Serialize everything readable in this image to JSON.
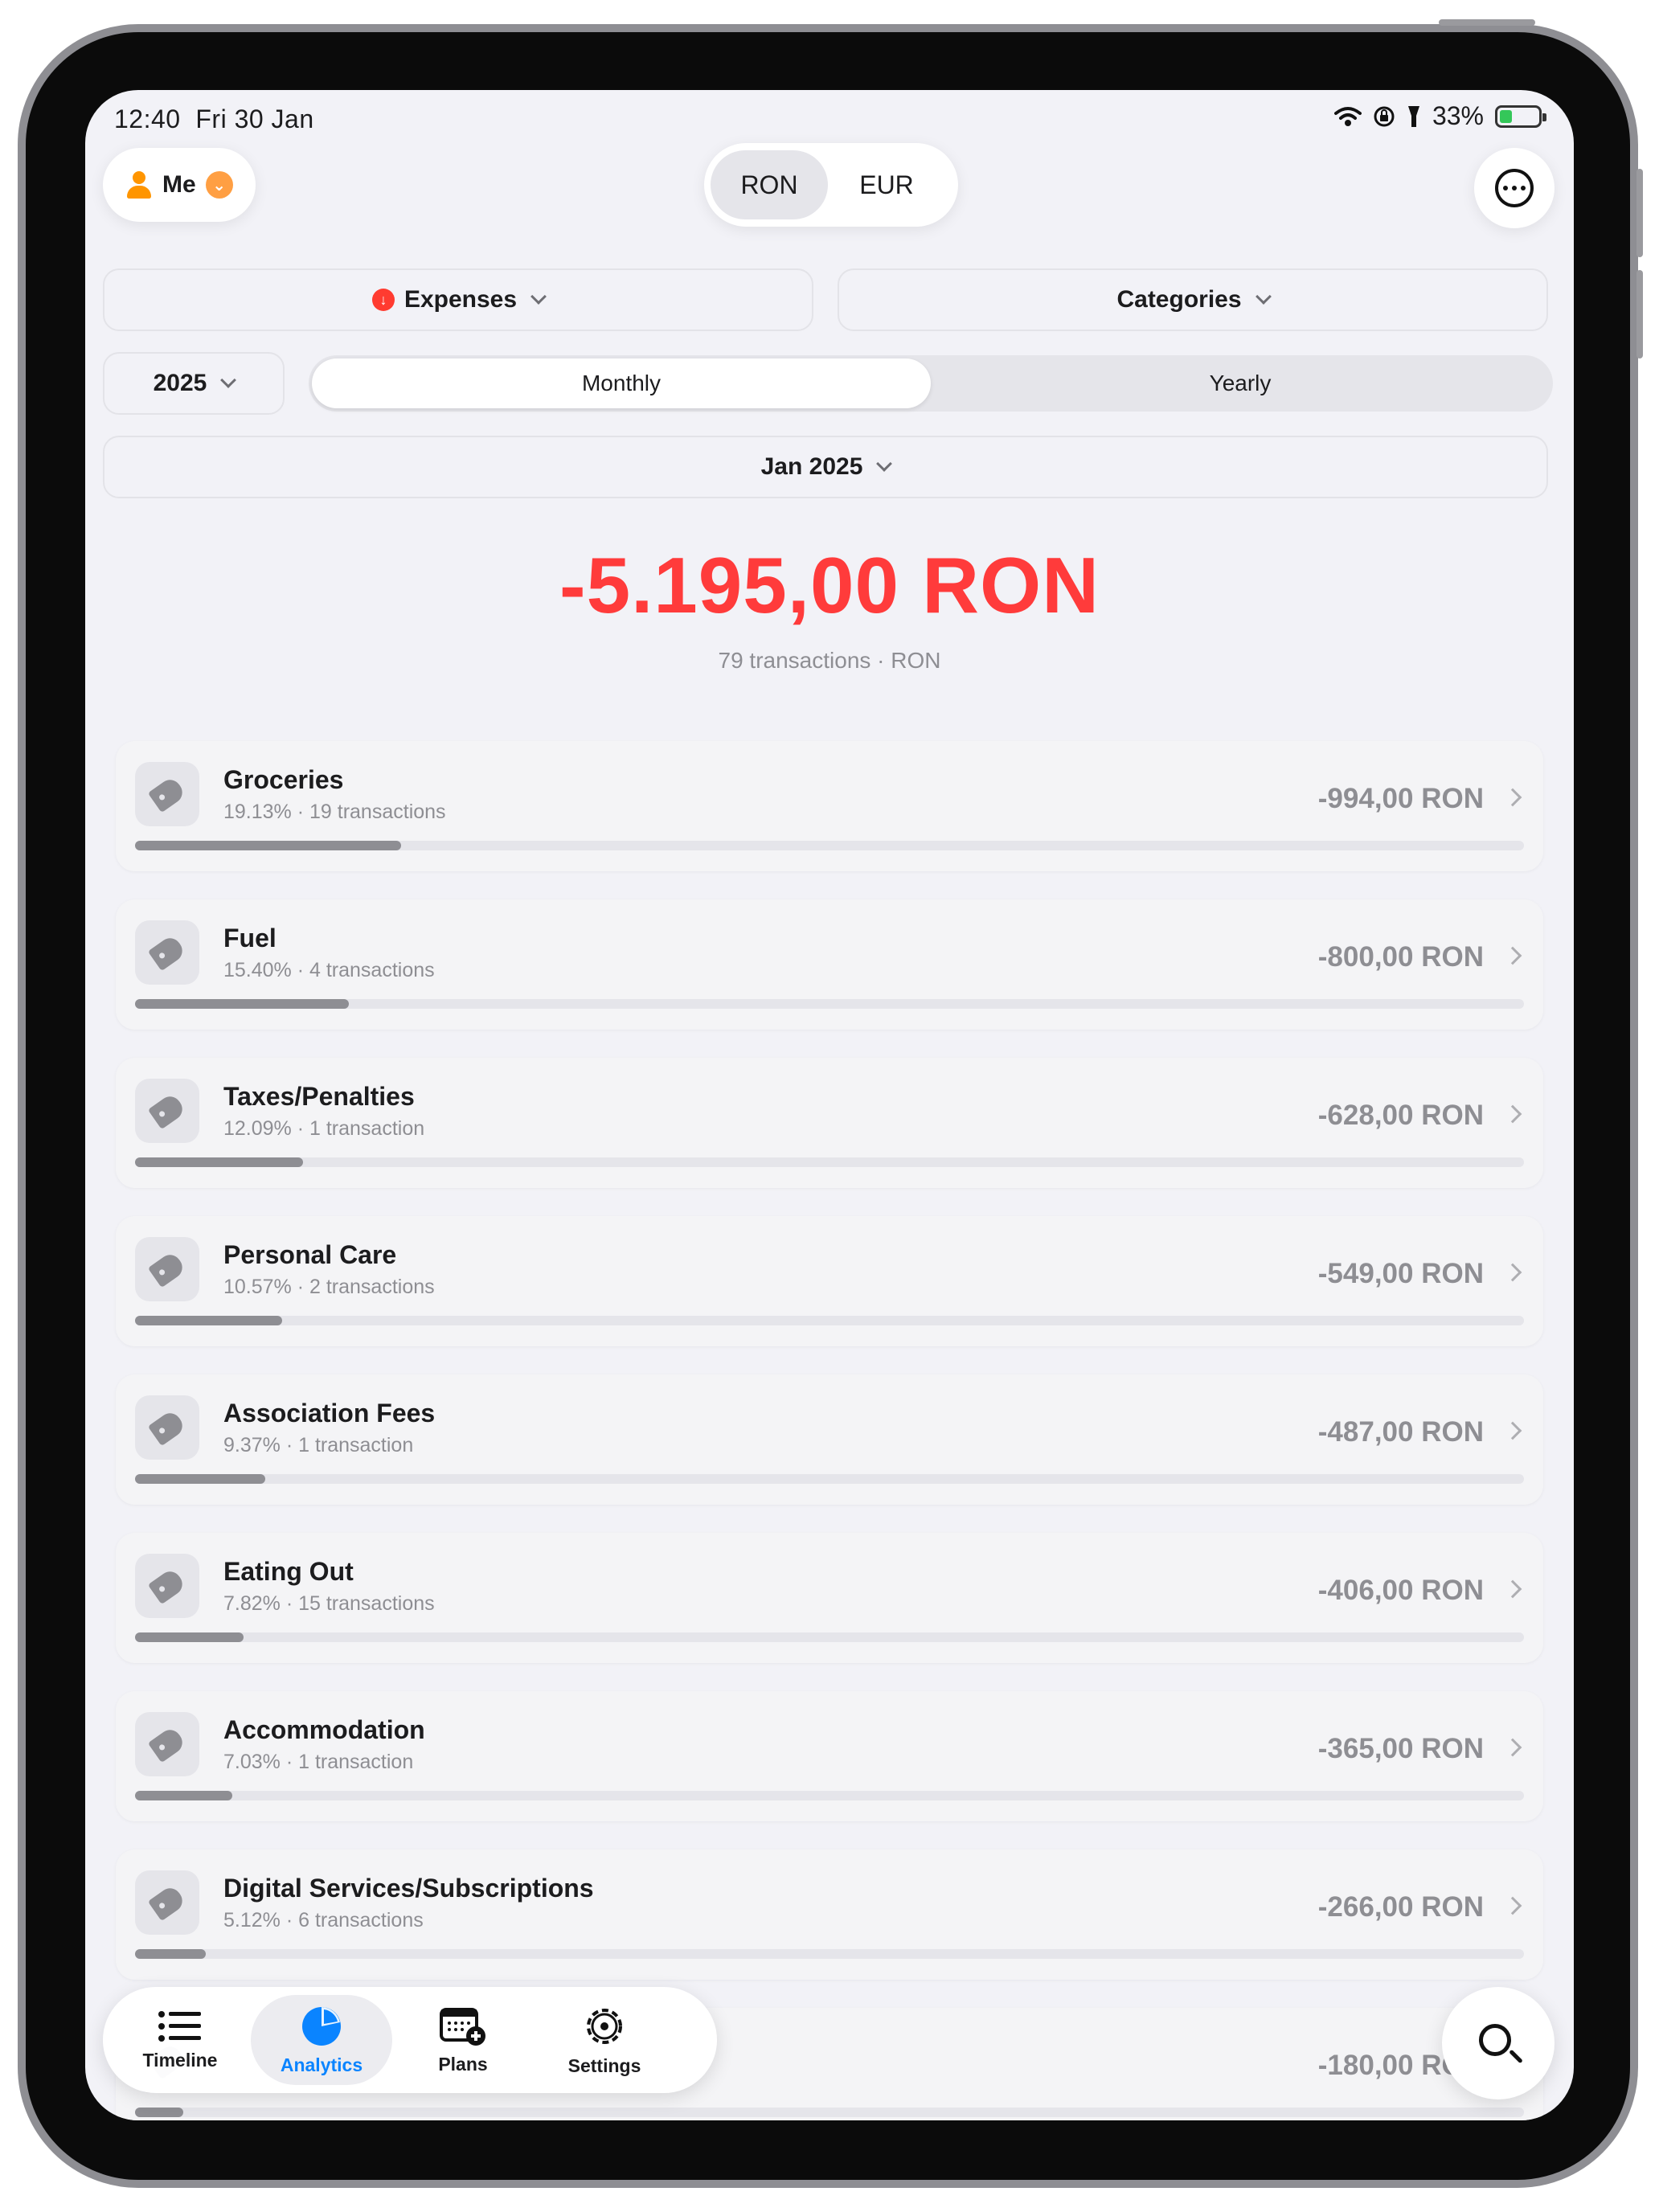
{
  "status": {
    "time": "12:40",
    "date": "Fri 30 Jan",
    "battery": "33%"
  },
  "header": {
    "profile_label": "Me",
    "currencies": [
      "RON",
      "EUR"
    ],
    "selected_currency": "RON"
  },
  "filters": {
    "type_label": "Expenses",
    "group_label": "Categories",
    "year_label": "2025",
    "periods": [
      "Monthly",
      "Yearly"
    ],
    "selected_period": "Monthly",
    "month_label": "Jan 2025"
  },
  "summary": {
    "total": "-5.195,00 RON",
    "subtitle": "79 transactions · RON"
  },
  "categories": [
    {
      "name": "Groceries",
      "meta": "19.13% · 19 transactions",
      "amount": "-994,00 RON",
      "share": 0.1913
    },
    {
      "name": "Fuel",
      "meta": "15.40% · 4 transactions",
      "amount": "-800,00 RON",
      "share": 0.154
    },
    {
      "name": "Taxes/Penalties",
      "meta": "12.09% · 1 transaction",
      "amount": "-628,00 RON",
      "share": 0.1209
    },
    {
      "name": "Personal Care",
      "meta": "10.57% · 2 transactions",
      "amount": "-549,00 RON",
      "share": 0.1057
    },
    {
      "name": "Association Fees",
      "meta": "9.37% · 1 transaction",
      "amount": "-487,00 RON",
      "share": 0.0937
    },
    {
      "name": "Eating Out",
      "meta": "7.82% · 15 transactions",
      "amount": "-406,00 RON",
      "share": 0.0782
    },
    {
      "name": "Accommodation",
      "meta": "7.03% · 1 transaction",
      "amount": "-365,00 RON",
      "share": 0.0703
    },
    {
      "name": "Digital Services/Subscriptions",
      "meta": "5.12% · 6 transactions",
      "amount": "-266,00 RON",
      "share": 0.0512
    },
    {
      "name": "",
      "meta": "",
      "amount": "-180,00 RON",
      "share": 0.035
    }
  ],
  "tabs": [
    {
      "label": "Timeline",
      "icon": "list-icon"
    },
    {
      "label": "Analytics",
      "icon": "pie-chart-icon"
    },
    {
      "label": "Plans",
      "icon": "calendar-plus-icon"
    },
    {
      "label": "Settings",
      "icon": "gear-icon"
    }
  ],
  "selected_tab": "Analytics",
  "colors": {
    "expense": "#ff3b3b",
    "accent": "#0a84ff",
    "background": "#f2f2f7"
  }
}
